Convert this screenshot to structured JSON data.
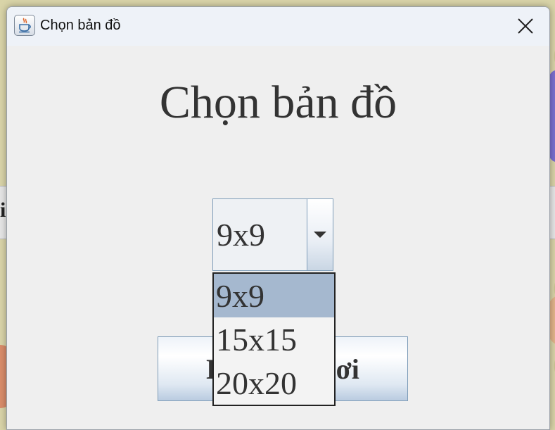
{
  "window": {
    "title": "Chọn bản đồ",
    "app_icon": "java-cup-icon",
    "close_icon": "close-icon"
  },
  "dialog": {
    "heading": "Chọn bản đồ",
    "map_select": {
      "selected": "9x9",
      "options": [
        "9x9",
        "15x15",
        "20x20"
      ],
      "highlighted_index": 0
    },
    "action_button_label": "Bắt đầu chơi"
  },
  "background": {
    "strip_text": "i"
  },
  "colors": {
    "highlight": "#a5b8cf",
    "title_bar": "#eef2f8",
    "dialog_bg": "#efefef",
    "text": "#333333"
  }
}
